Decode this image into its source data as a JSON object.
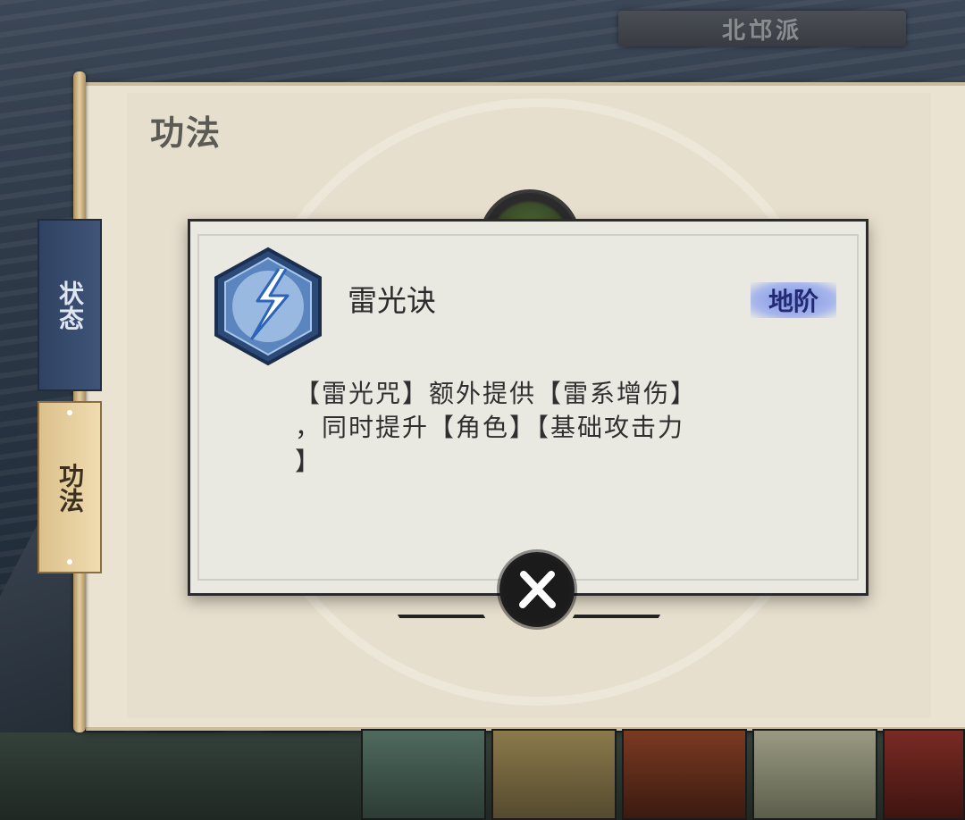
{
  "header": {
    "faction_name": "北邙派"
  },
  "panel": {
    "title": "功法"
  },
  "side_tabs": [
    {
      "label": "状态",
      "active": false
    },
    {
      "label": "功法",
      "active": true
    }
  ],
  "dialog": {
    "skill_name": "雷光诀",
    "rank": "地阶",
    "description_lines": [
      "【雷光咒】额外提供【雷系增伤】",
      "，同时提升【角色】【基础攻击力",
      "】"
    ],
    "icon": "lightning-bolt-icon",
    "close_icon": "close-icon"
  },
  "colors": {
    "rank_badge": "#7f93e0",
    "tab_active": "#f0dcb0",
    "tab_inactive": "#3f5478"
  }
}
